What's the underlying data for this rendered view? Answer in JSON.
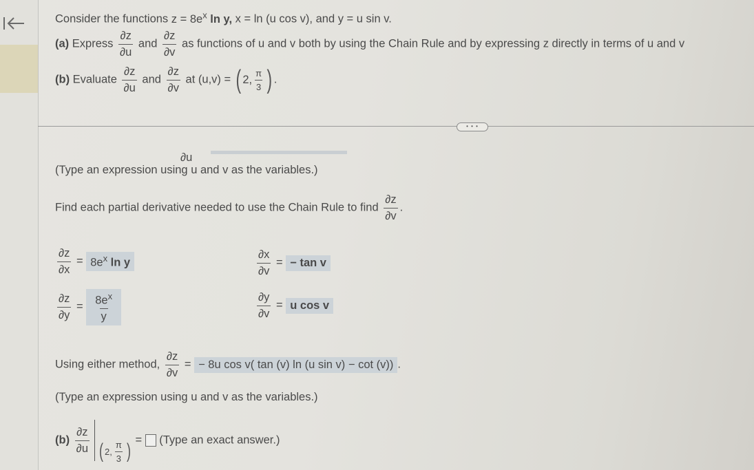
{
  "sidebar": {
    "collapse_icon": "collapse-left-icon"
  },
  "problem": {
    "intro_prefix": "Consider the functions",
    "z_def": "z = 8e",
    "z_exp": "x",
    "z_rest": " ln y,",
    "x_def": "x = ln (u cos v),",
    "and": "and",
    "y_def": "y = u sin v.",
    "part_a_label": "(a)",
    "part_a_express": "Express",
    "dz": "∂z",
    "du": "∂u",
    "dv": "∂v",
    "and_word": "and",
    "part_a_rest": "as functions of u and v both by using the Chain Rule and by expressing z directly in terms of u and v",
    "part_b_label": "(b)",
    "part_b_evaluate": "Evaluate",
    "part_b_at": "at (u,v) =",
    "point_u": "2,",
    "pi": "π",
    "three": "3",
    "period": "."
  },
  "more_button": {
    "label": "• • •"
  },
  "work": {
    "partial_du": "∂u",
    "hint1": "(Type an expression using u and v as the variables.)",
    "find_text": "Find each partial derivative needed to use the Chain Rule to find",
    "period": ".",
    "dzdx": {
      "num": "∂z",
      "den": "∂x",
      "answer_base": "8e",
      "answer_exp": "x",
      "answer_rest": " ln y"
    },
    "dzdy": {
      "num": "∂z",
      "den": "∂y",
      "answer_num_base": "8e",
      "answer_num_exp": "x",
      "answer_den": "y"
    },
    "dxdv": {
      "num": "∂x",
      "den": "∂v",
      "answer": "− tan v"
    },
    "dydv": {
      "num": "∂y",
      "den": "∂v",
      "answer": "u cos v"
    },
    "equals": "=",
    "either_prefix": "Using either method,",
    "either_num": "∂z",
    "either_den": "∂v",
    "either_answer": "− 8u cos v( tan (v) ln (u sin v) −  cot (v))",
    "hint2": "(Type an expression using u and v as the variables.)",
    "b_label": "(b)",
    "b_num": "∂z",
    "b_den": "∂u",
    "b_point_u": "2,",
    "b_pi": "π",
    "b_three": "3",
    "b_answer_value": "",
    "b_hint": "(Type an exact answer.)"
  }
}
